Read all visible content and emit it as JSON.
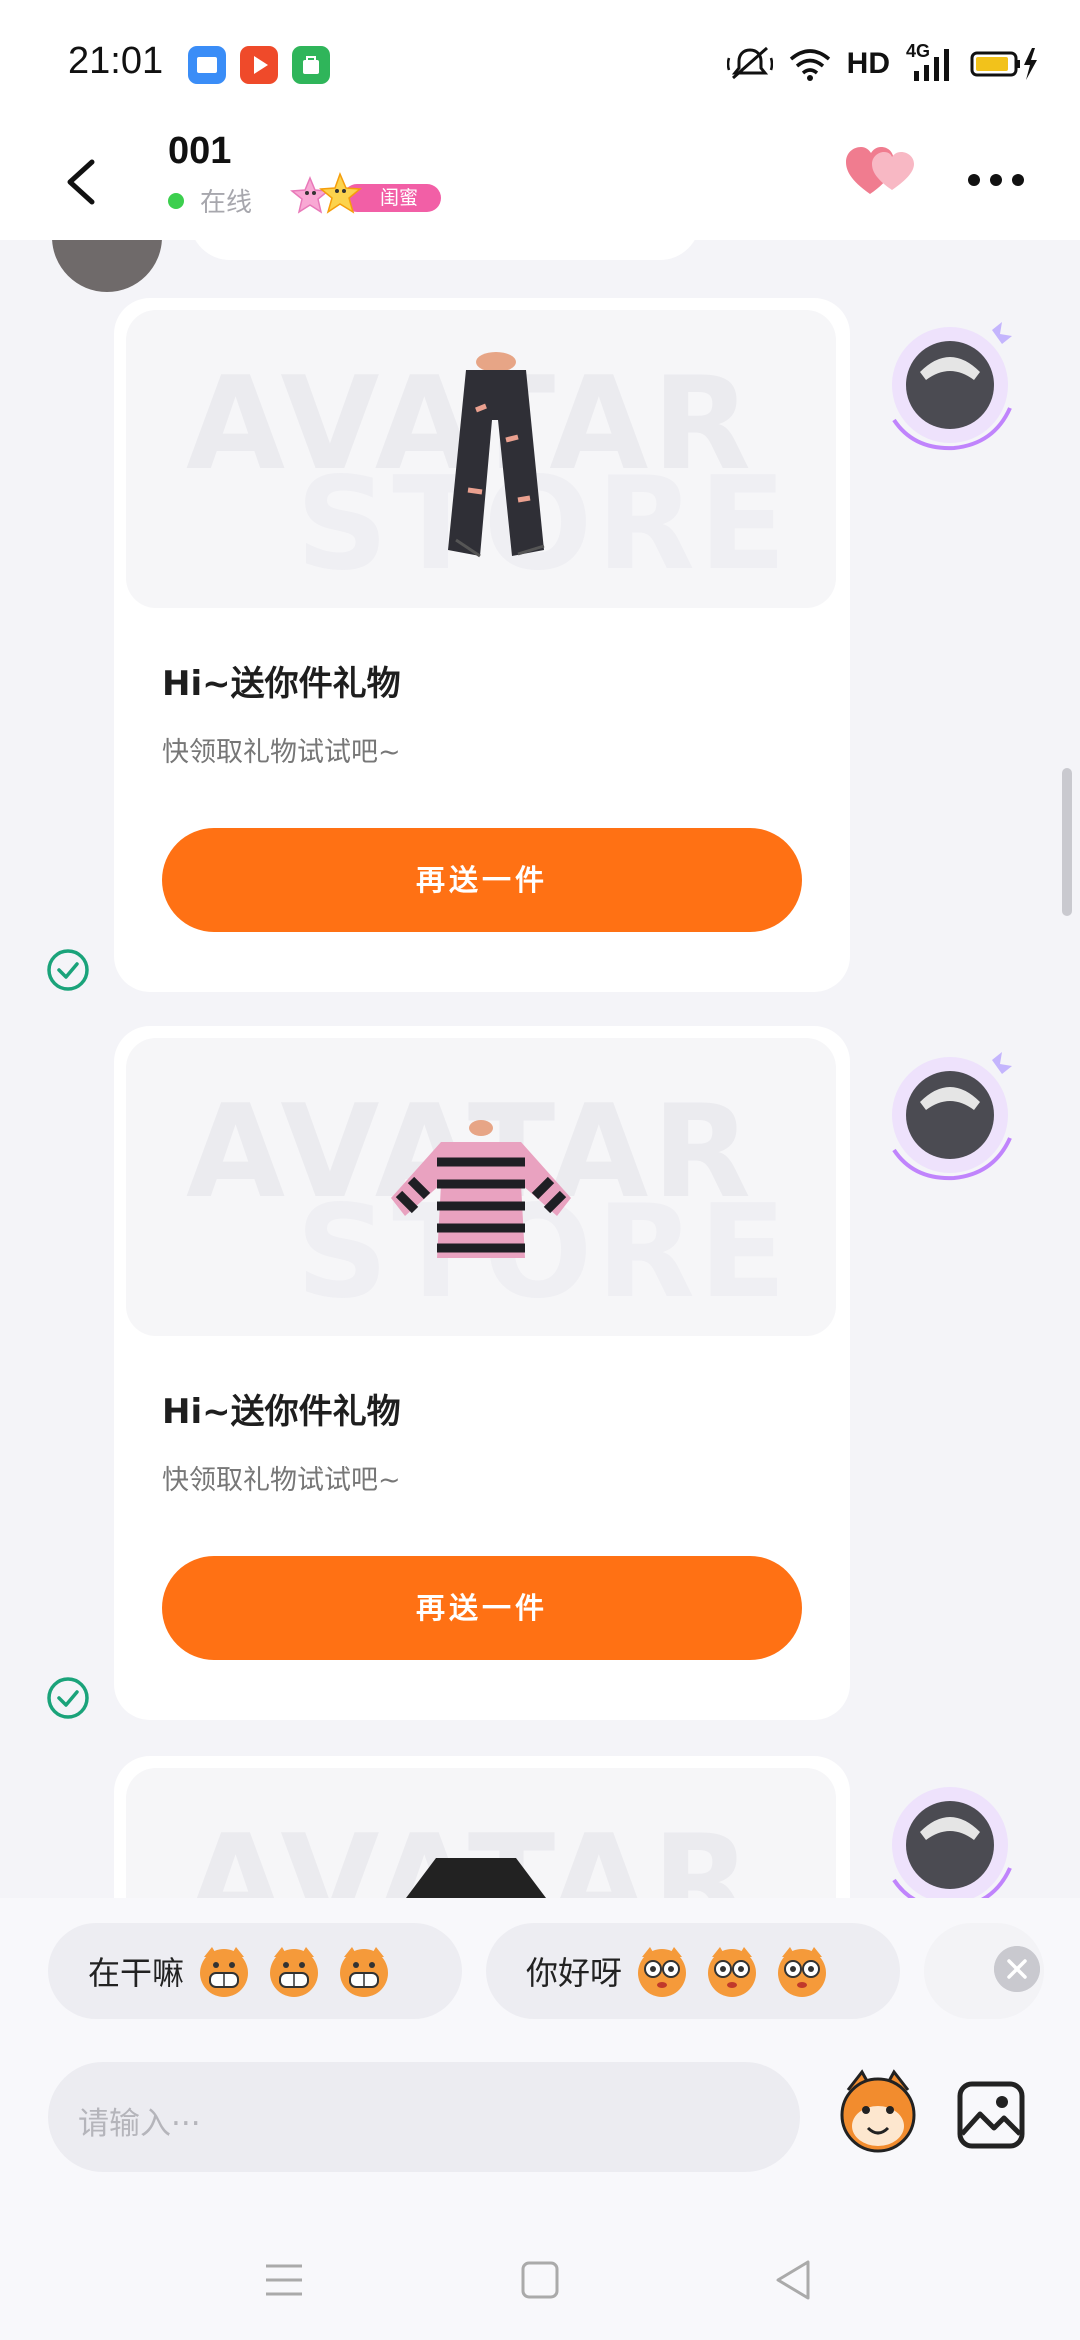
{
  "status_bar": {
    "time": "21:01",
    "hd": "HD",
    "network": "4G"
  },
  "header": {
    "title": "001",
    "status": "在线",
    "relationship_badge": "闺蜜"
  },
  "gift_cards": [
    {
      "title": "Hi~送你件礼物",
      "subtitle": "快领取礼物试试吧~",
      "button": "再送一件",
      "item": "jeans"
    },
    {
      "title": "Hi~送你件礼物",
      "subtitle": "快领取礼物试试吧~",
      "button": "再送一件",
      "item": "striped-sweater"
    },
    {
      "item": "dark-top"
    }
  ],
  "watermark": {
    "line1": "AVATAR",
    "line2": "STORE"
  },
  "quick_replies": [
    {
      "text": "在干嘛",
      "emoji_count": 3
    },
    {
      "text": "你好呀",
      "emoji_count": 3
    }
  ],
  "input": {
    "placeholder": "请输入···"
  },
  "colors": {
    "accent": "#ff7114",
    "online": "#3ccf4e",
    "check": "#1aa37a",
    "badge": "#f25fa6"
  }
}
